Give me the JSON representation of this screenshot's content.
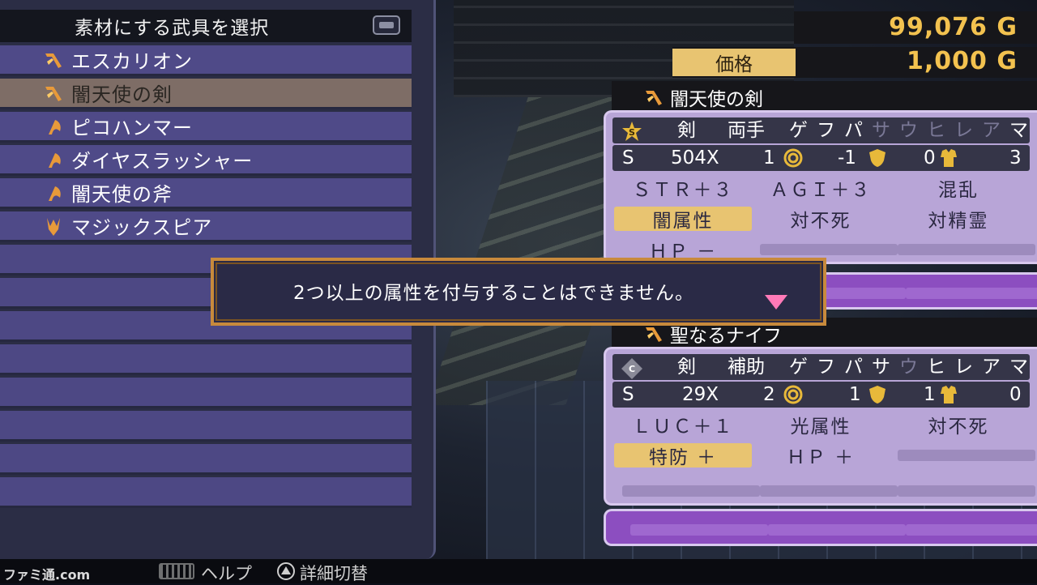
{
  "header": {
    "title": "素材にする武具を選択"
  },
  "weapon_list": [
    {
      "name": "エスカリオン",
      "icon": "sword-icon",
      "selected": false
    },
    {
      "name": "闇天使の剣",
      "icon": "sword-icon",
      "selected": true
    },
    {
      "name": "ピコハンマー",
      "icon": "axe-icon",
      "selected": false
    },
    {
      "name": "ダイヤスラッシャー",
      "icon": "axe-icon",
      "selected": false
    },
    {
      "name": "闇天使の斧",
      "icon": "axe-icon",
      "selected": false
    },
    {
      "name": "マジックスピア",
      "icon": "spear-icon",
      "selected": false
    }
  ],
  "gold": "99,076 G",
  "price": {
    "label": "価格",
    "value": "1,000 G"
  },
  "target_weapon": {
    "name": "闇天使の剣",
    "grade": "S",
    "type": "剣",
    "hand": "両手",
    "slot_level": "S",
    "attack": "504X",
    "attack_mult": "1",
    "val_a": "-1",
    "val_b": "0",
    "val_c": "3",
    "resist_labels": [
      "ゲ",
      "フ",
      "パ",
      "サ",
      "ウ",
      "ヒ",
      "レ",
      "ア",
      "マ"
    ],
    "resist_active": [
      true,
      true,
      true,
      false,
      false,
      false,
      false,
      false,
      true
    ],
    "mods": [
      "ＳＴＲ＋３",
      "ＡＧＩ＋３",
      "混乱",
      "闇属性",
      "対不死",
      "対精霊",
      "ＨＰ －"
    ]
  },
  "material_weapon": {
    "name": "聖なるナイフ",
    "grade": "C",
    "type": "剣",
    "hand": "補助",
    "slot_level": "S",
    "attack": "29X",
    "attack_mult": "2",
    "val_a": "1",
    "val_b": "1",
    "val_c": "0",
    "resist_labels": [
      "ゲ",
      "フ",
      "パ",
      "サ",
      "ウ",
      "ヒ",
      "レ",
      "ア",
      "マ"
    ],
    "resist_active": [
      true,
      true,
      true,
      true,
      false,
      true,
      true,
      true,
      true
    ],
    "mods": [
      "ＬＵＣ＋１",
      "光属性",
      "対不死",
      "特防 ＋",
      "ＨＰ ＋"
    ]
  },
  "dialog": {
    "message": "2つ以上の属性を付与することはできません。"
  },
  "footer": {
    "help": "ヘルプ",
    "detail_toggle": "詳細切替",
    "watermark": "ファミ通.com"
  },
  "colors": {
    "gold": "#f3c24f",
    "highlight": "#e8c471",
    "card": "#b8a5d7",
    "list_row": "#4f4a88",
    "dialog_border": "#c88a3c"
  }
}
